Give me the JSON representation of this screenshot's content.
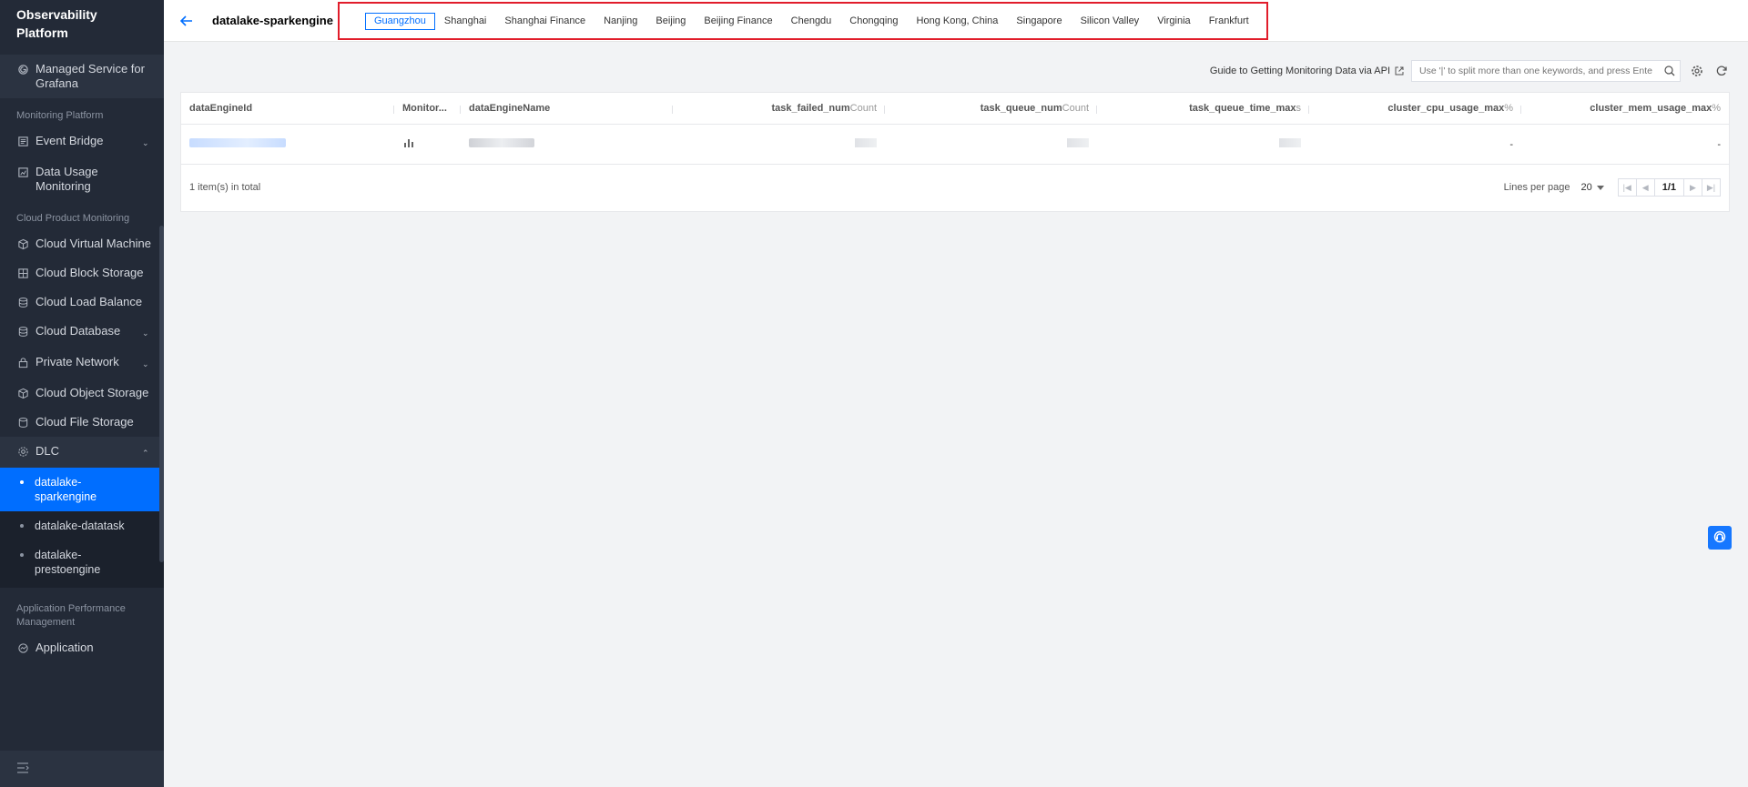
{
  "sidebar": {
    "brand": "Observability Platform",
    "top_item": {
      "label": "Managed Service for Grafana",
      "icon": "grafana-icon"
    },
    "sections": [
      {
        "label": "Monitoring Platform"
      },
      {
        "label": "Cloud Product Monitoring"
      },
      {
        "label": "Application Performance Management"
      }
    ],
    "items": {
      "event_bridge": {
        "label": "Event Bridge",
        "icon": "event-bridge-icon"
      },
      "data_usage": {
        "label": "Data Usage Monitoring",
        "icon": "chart-icon"
      },
      "cvm": {
        "label": "Cloud Virtual Machine",
        "icon": "cube-icon"
      },
      "cbs": {
        "label": "Cloud Block Storage",
        "icon": "block-storage-icon"
      },
      "clb": {
        "label": "Cloud Load Balance",
        "icon": "database-icon"
      },
      "cdb": {
        "label": "Cloud Database",
        "icon": "database-icon"
      },
      "vpc": {
        "label": "Private Network",
        "icon": "lock-icon"
      },
      "cos": {
        "label": "Cloud Object Storage",
        "icon": "cube-icon"
      },
      "cfs": {
        "label": "Cloud File Storage",
        "icon": "database-icon"
      },
      "dlc": {
        "label": "DLC",
        "icon": "gear-icon"
      },
      "apm": {
        "label": "Application",
        "icon": "globe-icon"
      }
    },
    "dlc_children": [
      {
        "label": "datalake-sparkengine",
        "active": true
      },
      {
        "label": "datalake-datatask",
        "active": false
      },
      {
        "label": "datalake-prestoengine",
        "active": false
      }
    ]
  },
  "header": {
    "title": "datalake-sparkengine",
    "regions": [
      "Guangzhou",
      "Shanghai",
      "Shanghai Finance",
      "Nanjing",
      "Beijing",
      "Beijing Finance",
      "Chengdu",
      "Chongqing",
      "Hong Kong, China",
      "Singapore",
      "Silicon Valley",
      "Virginia",
      "Frankfurt"
    ],
    "active_region": "Guangzhou"
  },
  "toolbar": {
    "guide_link": "Guide to Getting Monitoring Data via API",
    "search_placeholder": "Use '|' to split more than one keywords, and press Enter to split"
  },
  "table": {
    "columns": [
      {
        "name": "dataEngineId",
        "unit": ""
      },
      {
        "name": "Monitor...",
        "unit": ""
      },
      {
        "name": "dataEngineName",
        "unit": ""
      },
      {
        "name": "task_failed_num",
        "unit": "Count"
      },
      {
        "name": "task_queue_num",
        "unit": "Count"
      },
      {
        "name": "task_queue_time_max",
        "unit": "s"
      },
      {
        "name": "cluster_cpu_usage_max",
        "unit": "%"
      },
      {
        "name": "cluster_mem_usage_max",
        "unit": "%"
      }
    ],
    "row": {
      "cpu": "-",
      "mem": "-"
    },
    "total": "1 item(s) in total",
    "lines_per_page_label": "Lines per page",
    "page_size": "20",
    "page": "1/1"
  },
  "colors": {
    "accent": "#006eff",
    "sidebar_bg": "#232a37",
    "highlight_box": "#e11d2b"
  }
}
